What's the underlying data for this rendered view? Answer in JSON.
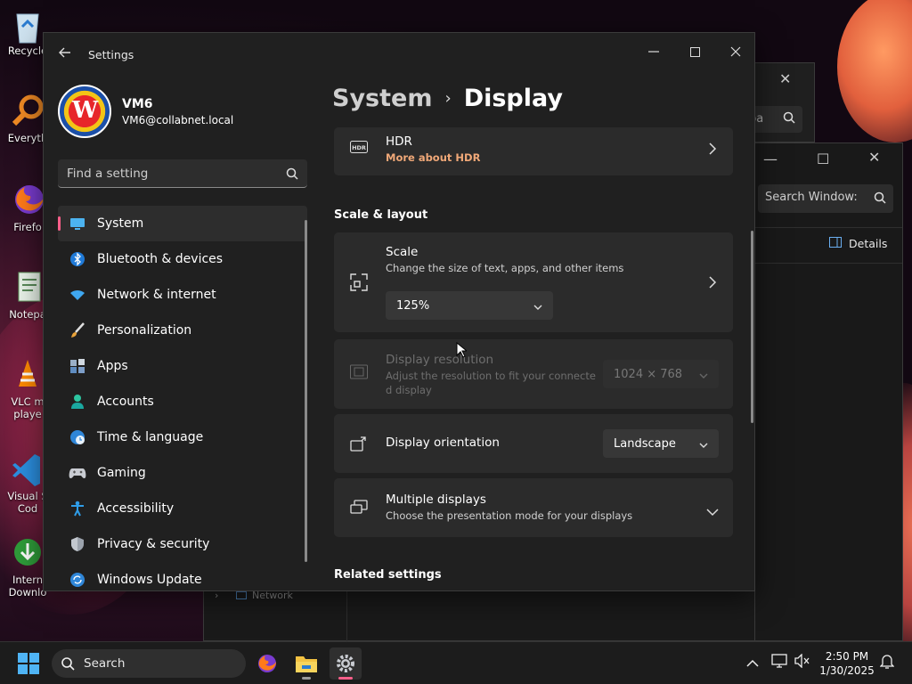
{
  "desktop": {
    "icons": [
      {
        "label": "Recycle"
      },
      {
        "label": "Everyth"
      },
      {
        "label": "Firefo"
      },
      {
        "label": "Notepa"
      },
      {
        "label": "VLC m playe"
      },
      {
        "label": "Visual S Cod"
      },
      {
        "label": "Intern Downlo"
      }
    ]
  },
  "background_windows": {
    "search1_placeholder": "ba",
    "search2_placeholder": "Search Window:",
    "details_label": "Details",
    "network_label": "Network"
  },
  "settings": {
    "window_title": "Settings",
    "profile": {
      "name": "VM6",
      "email": "VM6@collabnet.local"
    },
    "search_placeholder": "Find a setting",
    "nav": [
      {
        "label": "System",
        "icon": "monitor-icon",
        "active": true
      },
      {
        "label": "Bluetooth & devices",
        "icon": "bluetooth-icon"
      },
      {
        "label": "Network & internet",
        "icon": "wifi-icon"
      },
      {
        "label": "Personalization",
        "icon": "brush-icon"
      },
      {
        "label": "Apps",
        "icon": "apps-icon"
      },
      {
        "label": "Accounts",
        "icon": "person-icon"
      },
      {
        "label": "Time & language",
        "icon": "globe-clock-icon"
      },
      {
        "label": "Gaming",
        "icon": "controller-icon"
      },
      {
        "label": "Accessibility",
        "icon": "accessibility-icon"
      },
      {
        "label": "Privacy & security",
        "icon": "shield-icon"
      },
      {
        "label": "Windows Update",
        "icon": "update-icon"
      }
    ],
    "breadcrumb": {
      "parent": "System",
      "current": "Display"
    },
    "hdr": {
      "title": "HDR",
      "link": "More about HDR",
      "icon_text": "HDR"
    },
    "section_scale": "Scale & layout",
    "scale": {
      "title": "Scale",
      "subtitle": "Change the size of text, apps, and other items",
      "value": "125%"
    },
    "resolution": {
      "title": "Display resolution",
      "subtitle_line1": "Adjust the resolution to fit your connecte",
      "subtitle_line2": "d display",
      "value": "1024 × 768"
    },
    "orientation": {
      "title": "Display orientation",
      "value": "Landscape"
    },
    "multiple": {
      "title": "Multiple displays",
      "subtitle": "Choose the presentation mode for your displays"
    },
    "section_related": "Related settings"
  },
  "taskbar": {
    "search_label": "Search",
    "time": "2:50 PM",
    "date": "1/30/2025"
  },
  "colors": {
    "accent": "#ff5f8a",
    "hdr_link": "#f0a878",
    "window_bg": "#202020",
    "card_bg": "#2b2b2b"
  }
}
